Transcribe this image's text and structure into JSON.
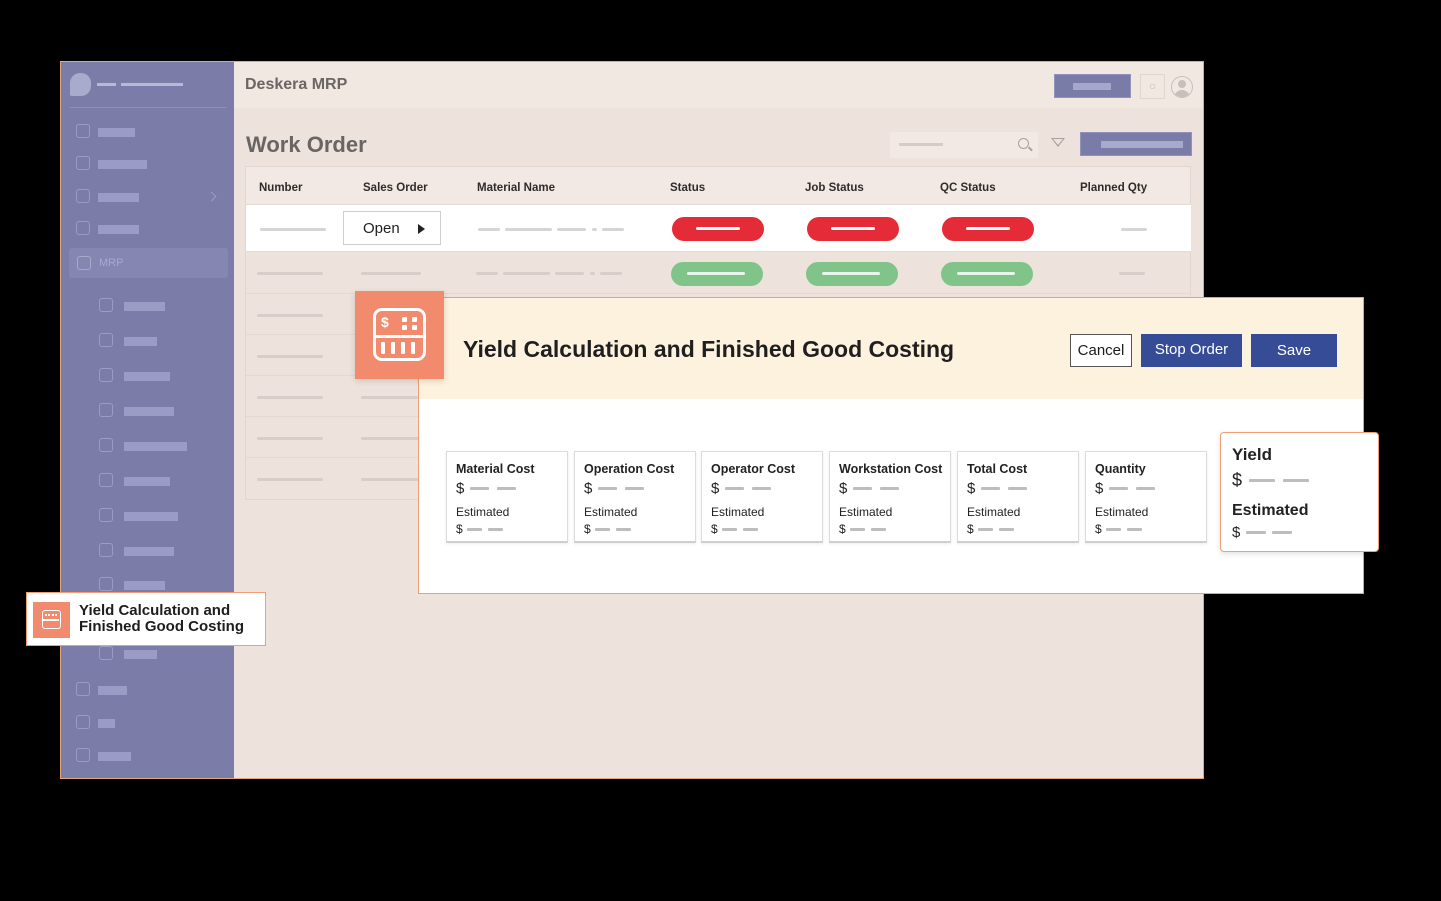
{
  "header": {
    "app_title": "Deskera MRP"
  },
  "sidebar": {
    "mrp_label": "MRP"
  },
  "main": {
    "page_title": "Work Order",
    "table": {
      "columns": [
        "Number",
        "Sales Order",
        "Material Name",
        "Status",
        "Job Status",
        "QC Status",
        "Planned Qty"
      ],
      "open_button_label": "Open"
    }
  },
  "modal": {
    "title": "Yield Calculation and Finished Good Costing",
    "cancel_label": "Cancel",
    "stop_order_label": "Stop Order",
    "save_label": "Save",
    "currency_symbol": "$",
    "estimated_label": "Estimated",
    "cards": [
      {
        "title": "Material Cost"
      },
      {
        "title": "Operation Cost"
      },
      {
        "title": "Operator Cost"
      },
      {
        "title": "Workstation Cost"
      },
      {
        "title": "Total Cost"
      },
      {
        "title": "Quantity"
      }
    ],
    "yield_card": {
      "title": "Yield"
    }
  },
  "callout": {
    "line1": "Yield Calculation and",
    "line2": "Finished Good Costing"
  },
  "colors": {
    "sidebar": "#7b7da8",
    "accent_orange": "#f28a6d",
    "primary_button": "#364c97",
    "status_red": "#e52b37",
    "status_green": "#80c48a",
    "modal_header": "#fdf2dd"
  },
  "icons": {
    "badge": "calculator-icon",
    "search": "search-icon",
    "filter": "filter-icon",
    "bell": "bell-icon",
    "avatar": "user-avatar-icon"
  }
}
